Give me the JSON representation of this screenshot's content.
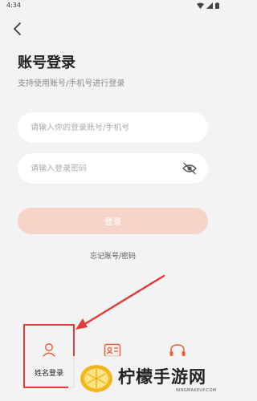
{
  "status_bar": {
    "time": "4:34"
  },
  "page": {
    "title": "账号登录",
    "subtitle": "支持使用账号/手机号进行登录"
  },
  "account_input": {
    "placeholder": "请输入你的登录账号/手机号",
    "value": ""
  },
  "password_input": {
    "placeholder": "请输入登录密码",
    "value": ""
  },
  "login_button": {
    "label": "登录"
  },
  "forgot_link": {
    "label": "忘记账号/密码"
  },
  "login_options": [
    {
      "label": "姓名登录",
      "icon": "person-icon"
    },
    {
      "label": "",
      "icon": "id-card-icon"
    },
    {
      "label": "",
      "icon": "headset-icon"
    }
  ],
  "watermark": {
    "brand": "柠檬手游网",
    "url": "NINGMAKEUP.COM"
  },
  "colors": {
    "accent": "#e8603c",
    "login_button_bg": "#f7d4c8",
    "highlight_red": "#e53935",
    "background": "#f3f3f3"
  }
}
